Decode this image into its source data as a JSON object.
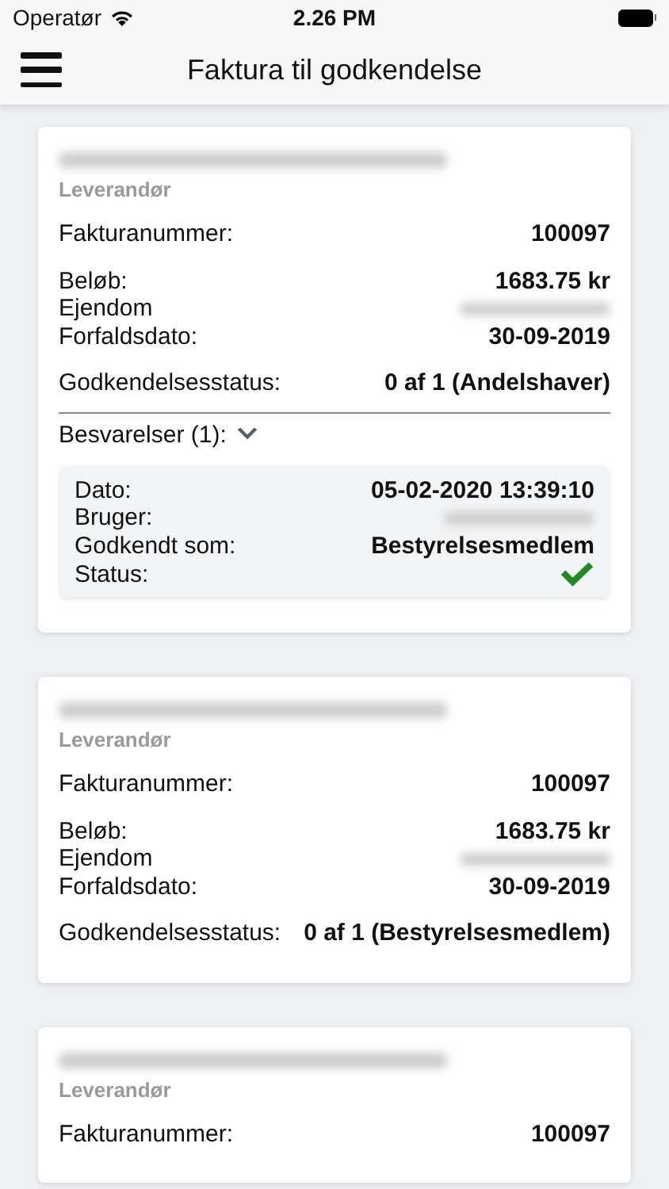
{
  "status_bar": {
    "carrier": "Operatør",
    "time": "2.26 PM"
  },
  "nav": {
    "title": "Faktura til godkendelse"
  },
  "cards": [
    {
      "supplier": {
        "redacted": true
      },
      "supplier_label": "Leverandør",
      "invoice": {
        "label": "Fakturanummer:",
        "value": "100097"
      },
      "details": [
        {
          "label": "Beløb:",
          "value": "1683.75 kr"
        },
        {
          "label": "Ejendom",
          "redacted": true
        },
        {
          "label": "Forfaldsdato:",
          "value": "30-09-2019"
        }
      ],
      "approval": {
        "label": "Godkendelsesstatus:",
        "value": "0 af 1 (Andelshaver)"
      },
      "responses": {
        "label": "Besvarelser (1):",
        "expanded": true,
        "items": [
          {
            "rows": [
              {
                "kind": "text",
                "label": "Dato:",
                "value": "05-02-2020 13:39:10"
              },
              {
                "kind": "redacted",
                "label": "Bruger:"
              },
              {
                "kind": "text",
                "label": "Godkendt som:",
                "value": "Bestyrelsesmedlem"
              },
              {
                "kind": "check",
                "label": "Status:",
                "approved": true
              }
            ]
          }
        ]
      }
    },
    {
      "supplier": {
        "redacted": true
      },
      "supplier_label": "Leverandør",
      "invoice": {
        "label": "Fakturanummer:",
        "value": "100097"
      },
      "details": [
        {
          "label": "Beløb:",
          "value": "1683.75 kr"
        },
        {
          "label": "Ejendom",
          "redacted": true
        },
        {
          "label": "Forfaldsdato:",
          "value": "30-09-2019"
        }
      ],
      "approval": {
        "label": "Godkendelsesstatus:",
        "value": "0 af 1 (Bestyrelsesmedlem)"
      }
    },
    {
      "supplier": {
        "redacted": true
      },
      "supplier_label": "Leverandør",
      "invoice": {
        "label": "Fakturanummer:",
        "value": "100097"
      }
    }
  ]
}
